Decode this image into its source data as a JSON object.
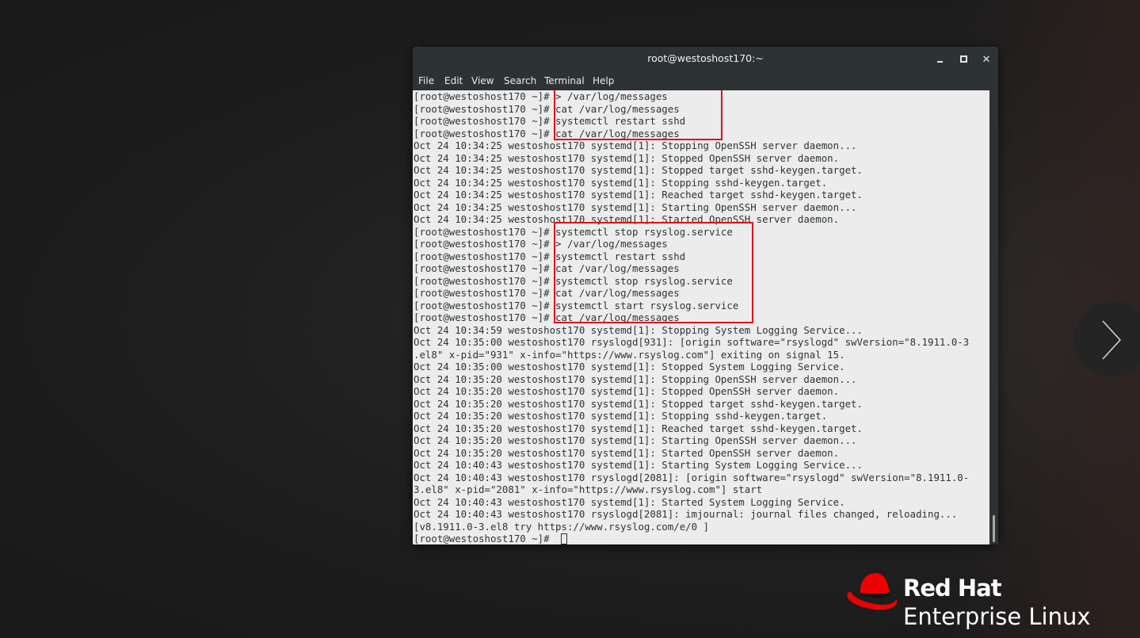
{
  "window": {
    "title": "root@westoshost170:~",
    "buttons": {
      "minimize": "minimize",
      "maximize": "maximize",
      "close": "✕"
    }
  },
  "menubar": {
    "items": [
      {
        "label": "File"
      },
      {
        "label": "Edit"
      },
      {
        "label": "View"
      },
      {
        "label": "Search"
      },
      {
        "label": "Terminal"
      },
      {
        "label": "Help"
      }
    ]
  },
  "terminal": {
    "prompt": "[root@westoshost170 ~]#",
    "lines": [
      "[root@westoshost170 ~]# > /var/log/messages",
      "[root@westoshost170 ~]# cat /var/log/messages",
      "[root@westoshost170 ~]# systemctl restart sshd",
      "[root@westoshost170 ~]# cat /var/log/messages",
      "Oct 24 10:34:25 westoshost170 systemd[1]: Stopping OpenSSH server daemon...",
      "Oct 24 10:34:25 westoshost170 systemd[1]: Stopped OpenSSH server daemon.",
      "Oct 24 10:34:25 westoshost170 systemd[1]: Stopped target sshd-keygen.target.",
      "Oct 24 10:34:25 westoshost170 systemd[1]: Stopping sshd-keygen.target.",
      "Oct 24 10:34:25 westoshost170 systemd[1]: Reached target sshd-keygen.target.",
      "Oct 24 10:34:25 westoshost170 systemd[1]: Starting OpenSSH server daemon...",
      "Oct 24 10:34:25 westoshost170 systemd[1]: Started OpenSSH server daemon.",
      "[root@westoshost170 ~]# systemctl stop rsyslog.service",
      "[root@westoshost170 ~]# > /var/log/messages",
      "[root@westoshost170 ~]# systemctl restart sshd",
      "[root@westoshost170 ~]# cat /var/log/messages",
      "[root@westoshost170 ~]# systemctl stop rsyslog.service",
      "[root@westoshost170 ~]# cat /var/log/messages",
      "[root@westoshost170 ~]# systemctl start rsyslog.service",
      "[root@westoshost170 ~]# cat /var/log/messages",
      "Oct 24 10:34:59 westoshost170 systemd[1]: Stopping System Logging Service...",
      "Oct 24 10:35:00 westoshost170 rsyslogd[931]: [origin software=\"rsyslogd\" swVersion=\"8.1911.0-3",
      ".el8\" x-pid=\"931\" x-info=\"https://www.rsyslog.com\"] exiting on signal 15.",
      "Oct 24 10:35:00 westoshost170 systemd[1]: Stopped System Logging Service.",
      "Oct 24 10:35:20 westoshost170 systemd[1]: Stopping OpenSSH server daemon...",
      "Oct 24 10:35:20 westoshost170 systemd[1]: Stopped OpenSSH server daemon.",
      "Oct 24 10:35:20 westoshost170 systemd[1]: Stopped target sshd-keygen.target.",
      "Oct 24 10:35:20 westoshost170 systemd[1]: Stopping sshd-keygen.target.",
      "Oct 24 10:35:20 westoshost170 systemd[1]: Reached target sshd-keygen.target.",
      "Oct 24 10:35:20 westoshost170 systemd[1]: Starting OpenSSH server daemon...",
      "Oct 24 10:35:20 westoshost170 systemd[1]: Started OpenSSH server daemon.",
      "Oct 24 10:40:43 westoshost170 systemd[1]: Starting System Logging Service...",
      "Oct 24 10:40:43 westoshost170 rsyslogd[2081]: [origin software=\"rsyslogd\" swVersion=\"8.1911.0-",
      "3.el8\" x-pid=\"2081\" x-info=\"https://www.rsyslog.com\"] start",
      "Oct 24 10:40:43 westoshost170 systemd[1]: Started System Logging Service.",
      "Oct 24 10:40:43 westoshost170 rsyslogd[2081]: imjournal: journal files changed, reloading...",
      "[v8.1911.0-3.el8 try https://www.rsyslog.com/e/0 ]",
      "[root@westoshost170 ~]# "
    ]
  },
  "branding": {
    "line1": "Red Hat",
    "line2": "Enterprise Linux"
  },
  "colors": {
    "highlight_box": "#e0101a",
    "terminal_bg": "#ececec",
    "terminal_fg": "#2e3436",
    "titlebar_bg": "#2d3234",
    "logo_red": "#ee0000"
  },
  "icons": {
    "next": "chevron-right-icon",
    "logo": "red-hat-fedora-icon"
  }
}
